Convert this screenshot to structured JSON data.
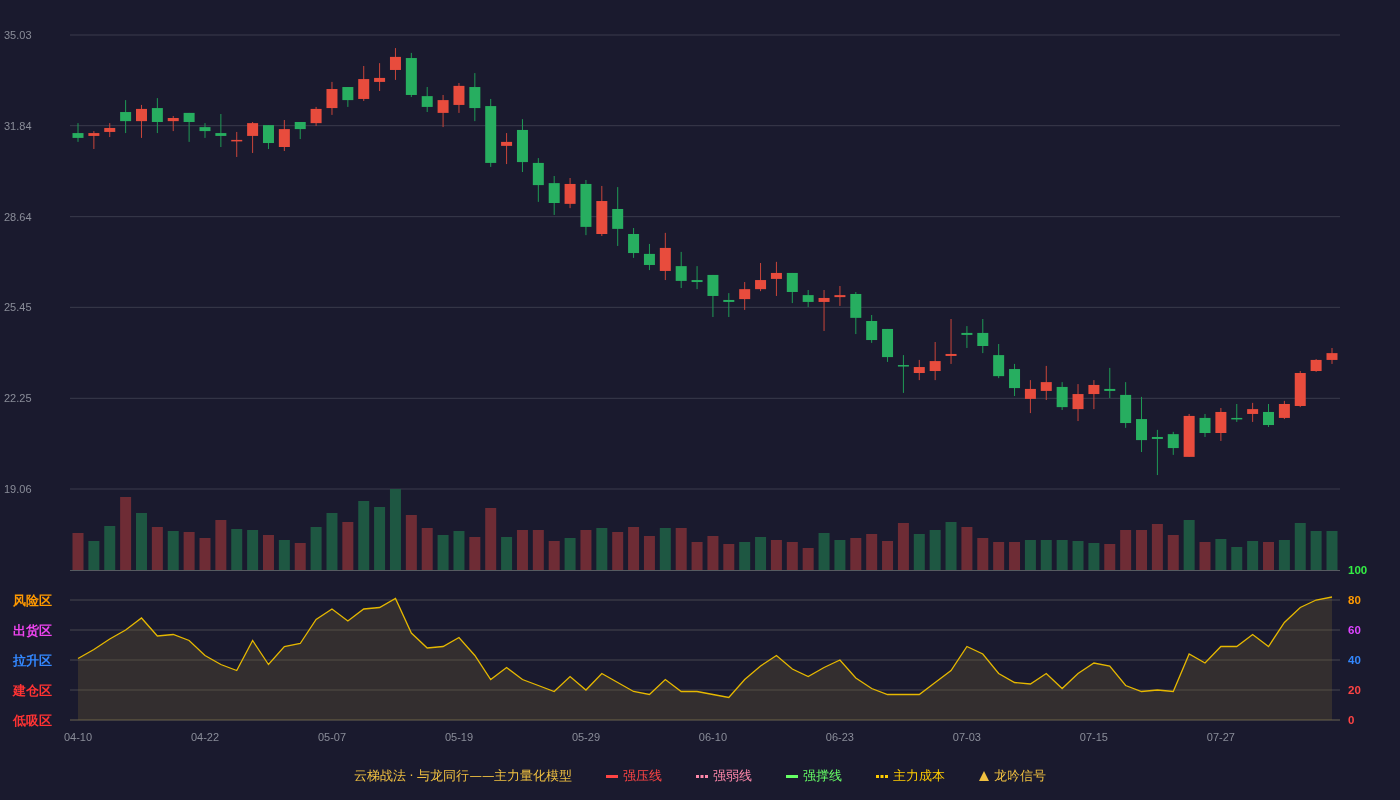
{
  "price_chart": {
    "chart_data": {
      "type": "candlestick",
      "grid": true,
      "categories": [
        null,
        null,
        null,
        null,
        null,
        null,
        null,
        null,
        null,
        null,
        null,
        null,
        null,
        null,
        null,
        null,
        null,
        null,
        null,
        null,
        null,
        null,
        null,
        null,
        null,
        null,
        null,
        null,
        null,
        null,
        null,
        null,
        null,
        null,
        null,
        null,
        null,
        null,
        null,
        null,
        null,
        null,
        null,
        null,
        null,
        null,
        null,
        null,
        null,
        null,
        null,
        null,
        null,
        null,
        null,
        null,
        null,
        null,
        null,
        null,
        null,
        null,
        null,
        null,
        null,
        null,
        null,
        null,
        null,
        null,
        null,
        null,
        null,
        null,
        null,
        null,
        null,
        null,
        null,
        null
      ],
      "ohlc": [
        [
          31.58,
          31.93,
          31.27,
          31.41
        ],
        [
          31.48,
          31.65,
          31.02,
          31.58
        ],
        [
          31.62,
          31.93,
          31.44,
          31.76
        ],
        [
          32.32,
          32.74,
          31.58,
          32.0
        ],
        [
          32.0,
          32.57,
          31.41,
          32.43
        ],
        [
          32.46,
          32.81,
          31.58,
          31.97
        ],
        [
          32.0,
          32.18,
          31.65,
          32.11
        ],
        [
          32.29,
          32.29,
          31.27,
          31.97
        ],
        [
          31.79,
          31.93,
          31.41,
          31.65
        ],
        [
          31.58,
          32.25,
          31.09,
          31.48
        ],
        [
          31.3,
          31.62,
          30.74,
          31.34
        ],
        [
          31.48,
          31.97,
          30.88,
          31.93
        ],
        [
          31.86,
          31.86,
          31.02,
          31.23
        ],
        [
          31.09,
          32.04,
          30.95,
          31.72
        ],
        [
          31.97,
          31.97,
          31.37,
          31.72
        ],
        [
          31.93,
          32.5,
          31.83,
          32.43
        ],
        [
          32.46,
          33.38,
          32.22,
          33.13
        ],
        [
          33.2,
          33.2,
          32.5,
          32.74
        ],
        [
          32.78,
          33.94,
          32.71,
          33.48
        ],
        [
          33.38,
          34.04,
          33.06,
          33.52
        ],
        [
          33.8,
          34.57,
          33.45,
          34.26
        ],
        [
          34.22,
          34.4,
          32.85,
          32.92
        ],
        [
          32.88,
          33.2,
          32.32,
          32.5
        ],
        [
          32.29,
          32.92,
          31.79,
          32.74
        ],
        [
          32.57,
          33.34,
          32.29,
          33.24
        ],
        [
          33.2,
          33.69,
          32.0,
          32.46
        ],
        [
          32.53,
          32.78,
          30.39,
          30.53
        ],
        [
          31.13,
          31.58,
          30.49,
          31.27
        ],
        [
          31.69,
          32.07,
          30.21,
          30.56
        ],
        [
          30.53,
          30.7,
          29.16,
          29.75
        ],
        [
          29.82,
          30.07,
          28.7,
          29.12
        ],
        [
          29.09,
          30.0,
          28.94,
          29.79
        ],
        [
          29.79,
          29.93,
          27.99,
          28.28
        ],
        [
          28.03,
          29.72,
          27.96,
          29.19
        ],
        [
          28.91,
          29.68,
          27.61,
          28.21
        ],
        [
          28.03,
          28.24,
          27.19,
          27.36
        ],
        [
          27.33,
          27.68,
          26.76,
          26.94
        ],
        [
          26.73,
          28.07,
          26.41,
          27.54
        ],
        [
          26.9,
          27.4,
          26.13,
          26.38
        ],
        [
          26.41,
          26.9,
          26.09,
          26.34
        ],
        [
          26.59,
          26.59,
          25.11,
          25.85
        ],
        [
          25.71,
          25.95,
          25.11,
          25.64
        ],
        [
          25.74,
          26.34,
          25.36,
          26.09
        ],
        [
          26.09,
          27.01,
          26.02,
          26.41
        ],
        [
          26.45,
          27.05,
          25.85,
          26.66
        ],
        [
          26.66,
          26.66,
          25.6,
          25.99
        ],
        [
          25.88,
          26.06,
          25.46,
          25.64
        ],
        [
          25.64,
          26.06,
          24.62,
          25.78
        ],
        [
          25.81,
          26.2,
          25.5,
          25.88
        ],
        [
          25.92,
          25.99,
          24.51,
          25.08
        ],
        [
          24.97,
          25.18,
          24.2,
          24.3
        ],
        [
          24.69,
          24.69,
          23.53,
          23.7
        ],
        [
          23.42,
          23.77,
          22.44,
          23.39
        ],
        [
          23.14,
          23.6,
          22.89,
          23.35
        ],
        [
          23.21,
          24.23,
          22.89,
          23.56
        ],
        [
          23.74,
          25.04,
          23.46,
          23.81
        ],
        [
          24.55,
          24.79,
          24.02,
          24.48
        ],
        [
          24.55,
          25.04,
          23.84,
          24.09
        ],
        [
          23.77,
          24.16,
          22.96,
          23.03
        ],
        [
          23.28,
          23.46,
          22.33,
          22.61
        ],
        [
          22.23,
          22.89,
          21.73,
          22.58
        ],
        [
          22.51,
          23.39,
          22.19,
          22.82
        ],
        [
          22.65,
          22.82,
          21.84,
          21.94
        ],
        [
          21.87,
          22.75,
          21.45,
          22.4
        ],
        [
          22.4,
          22.89,
          21.87,
          22.72
        ],
        [
          22.58,
          23.32,
          22.26,
          22.51
        ],
        [
          22.37,
          22.82,
          21.21,
          21.38
        ],
        [
          21.52,
          22.3,
          20.36,
          20.78
        ],
        [
          20.89,
          21.14,
          19.55,
          20.82
        ],
        [
          20.99,
          21.07,
          20.26,
          20.5
        ],
        [
          20.19,
          21.7,
          20.19,
          21.63
        ],
        [
          21.56,
          21.7,
          20.89,
          21.03
        ],
        [
          21.03,
          21.91,
          20.75,
          21.77
        ],
        [
          21.56,
          22.05,
          21.42,
          21.52
        ],
        [
          21.7,
          22.09,
          21.42,
          21.87
        ],
        [
          21.77,
          22.05,
          21.24,
          21.31
        ],
        [
          21.56,
          22.16,
          21.52,
          22.05
        ],
        [
          21.98,
          23.21,
          21.94,
          23.14
        ],
        [
          23.21,
          23.63,
          23.18,
          23.6
        ],
        [
          23.6,
          24.02,
          23.46,
          23.84
        ]
      ],
      "ylim": [
        19.06,
        35.03
      ],
      "yticks": [
        {
          "value": 35.03,
          "label": "35.03"
        },
        {
          "value": 31.84,
          "label": "31.84"
        },
        {
          "value": 28.64,
          "label": "28.64"
        },
        {
          "value": 25.45,
          "label": "25.45"
        },
        {
          "value": 22.25,
          "label": "22.25"
        },
        {
          "value": 19.06,
          "label": "19.06"
        }
      ]
    }
  },
  "indicator": {
    "zones": [
      {
        "label": "风险区",
        "color": "#ff9900"
      },
      {
        "label": "出货区",
        "color": "#ee44ee"
      },
      {
        "label": "拉升区",
        "color": "#3388ff"
      },
      {
        "label": "建仓区",
        "color": "#ff3333"
      },
      {
        "label": "低吸区",
        "color": "#ff3333"
      }
    ],
    "tick_styles": [
      {
        "color": "#ff4444"
      },
      {
        "color": "#ff4444"
      },
      {
        "color": "#3388ff"
      },
      {
        "color": "#dd44ff"
      },
      {
        "color": "#ff9900"
      },
      {
        "color": "#33ee44"
      }
    ],
    "chart_data": {
      "type": "area",
      "grid": true,
      "categories": [
        "04-10",
        null,
        null,
        null,
        null,
        null,
        null,
        null,
        "04-22",
        null,
        null,
        null,
        null,
        null,
        null,
        null,
        "05-07",
        null,
        null,
        null,
        null,
        null,
        null,
        null,
        "05-19",
        null,
        null,
        null,
        null,
        null,
        null,
        null,
        "05-29",
        null,
        null,
        null,
        null,
        null,
        null,
        null,
        "06-10",
        null,
        null,
        null,
        null,
        null,
        null,
        null,
        "06-23",
        null,
        null,
        null,
        null,
        null,
        null,
        null,
        "07-03",
        null,
        null,
        null,
        null,
        null,
        null,
        null,
        "07-15",
        null,
        null,
        null,
        null,
        null,
        null,
        null,
        "07-27",
        null,
        null,
        null,
        null,
        null,
        null,
        null
      ],
      "series": [
        {
          "color": "#e6b800",
          "values": [
            41,
            47,
            54,
            60,
            68,
            56,
            57,
            53,
            43,
            37,
            33,
            53,
            37,
            49,
            51,
            67,
            74,
            66,
            74,
            75,
            81,
            58,
            48,
            49,
            55,
            43,
            27,
            35,
            27,
            23,
            19,
            29,
            20,
            31,
            25,
            19,
            17,
            27,
            19,
            19,
            17,
            15,
            27,
            36,
            43,
            34,
            29,
            35,
            40,
            28,
            21,
            17,
            17,
            17,
            25,
            33,
            49,
            44,
            31,
            25,
            24,
            31,
            21,
            31,
            38,
            36,
            23,
            19,
            20,
            19,
            44,
            38,
            49,
            49,
            57,
            49,
            65,
            75,
            80,
            82
          ]
        }
      ],
      "ylim": [
        0,
        100
      ],
      "yticks": [
        0,
        20,
        40,
        60,
        80,
        100
      ]
    }
  },
  "legend": {
    "title": "云梯战法 · 与龙同行——主力量化模型",
    "items": [
      {
        "kind": "solid",
        "label": "强压线",
        "color": "#ff4444"
      },
      {
        "kind": "dashed",
        "label": "强弱线",
        "color": "#ff88aa"
      },
      {
        "kind": "solid",
        "label": "强撑线",
        "color": "#66ff66"
      },
      {
        "kind": "dashed",
        "label": "主力成本",
        "color": "#ffcc00"
      },
      {
        "kind": "triangle",
        "label": "龙吟信号",
        "color": "#f0c040"
      }
    ]
  }
}
